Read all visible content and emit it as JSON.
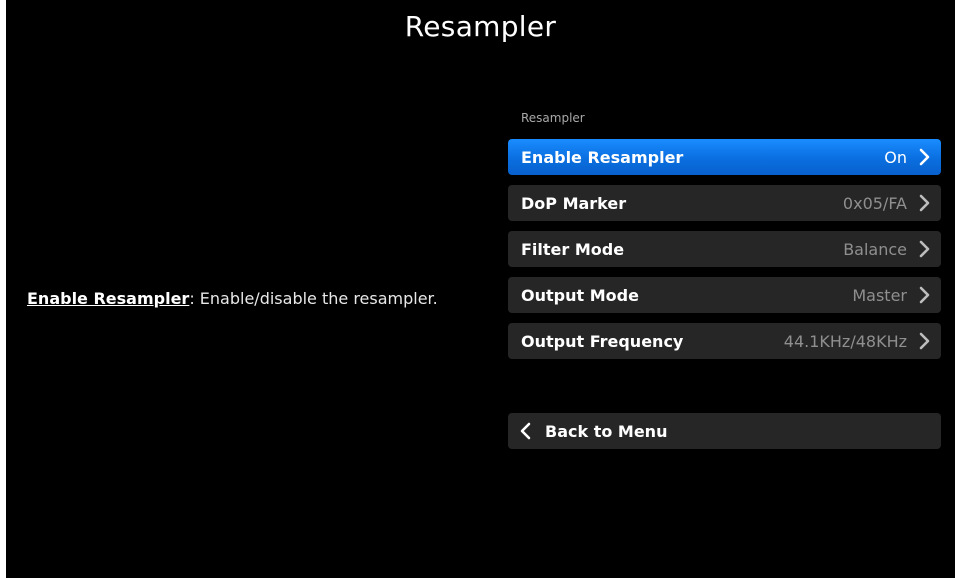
{
  "title": "Resampler",
  "help": {
    "term": "Enable Resampler",
    "description": ": Enable/disable the resampler."
  },
  "section_label": "Resampler",
  "menu": [
    {
      "label": "Enable Resampler",
      "value": "On",
      "selected": true
    },
    {
      "label": "DoP Marker",
      "value": "0x05/FA",
      "selected": false
    },
    {
      "label": "Filter Mode",
      "value": "Balance",
      "selected": false
    },
    {
      "label": "Output Mode",
      "value": "Master",
      "selected": false
    },
    {
      "label": "Output Frequency",
      "value": "44.1KHz/48KHz",
      "selected": false
    }
  ],
  "back_label": "Back to Menu",
  "icons": {
    "item_chevron": "chevron-right-icon",
    "back_chevron": "chevron-left-icon"
  },
  "colors": {
    "background": "#000000",
    "row": "#262626",
    "selected_row": "#0a6fe0",
    "value_text": "#8f8f8f"
  }
}
